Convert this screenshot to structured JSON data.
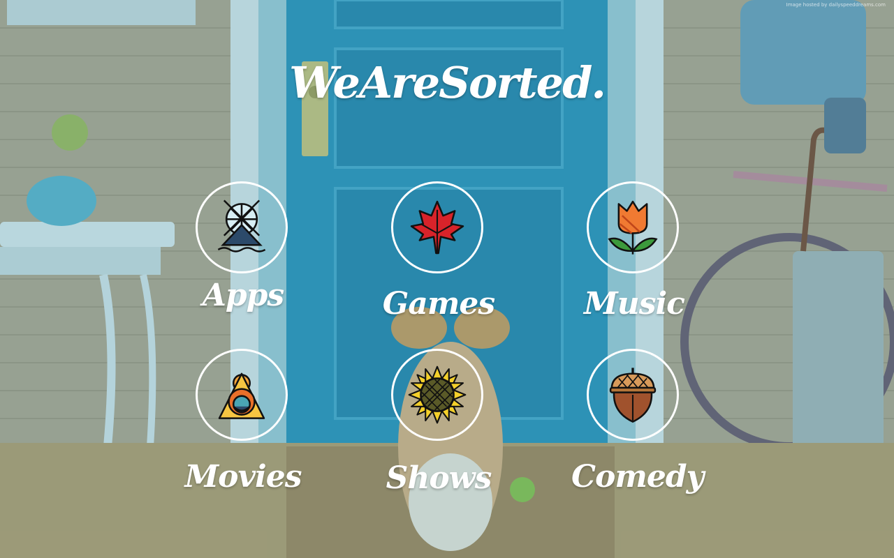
{
  "title": "WeAreSorted.",
  "watermark": "Image hosted by dailyspeeddreams.com",
  "tiles": [
    {
      "label": "Apps",
      "icon": "ferris-wheel-icon"
    },
    {
      "label": "Games",
      "icon": "maple-leaf-icon"
    },
    {
      "label": "Music",
      "icon": "tulip-icon"
    },
    {
      "label": "Movies",
      "icon": "triangle-face-icon"
    },
    {
      "label": "Shows",
      "icon": "sunflower-icon"
    },
    {
      "label": "Comedy",
      "icon": "acorn-icon"
    }
  ],
  "colors": {
    "accent": "#ffffff",
    "leaf": "#d8232a",
    "tulip": "#f07a32",
    "sunflower": "#f4d02a",
    "acorn": "#a0522d"
  }
}
